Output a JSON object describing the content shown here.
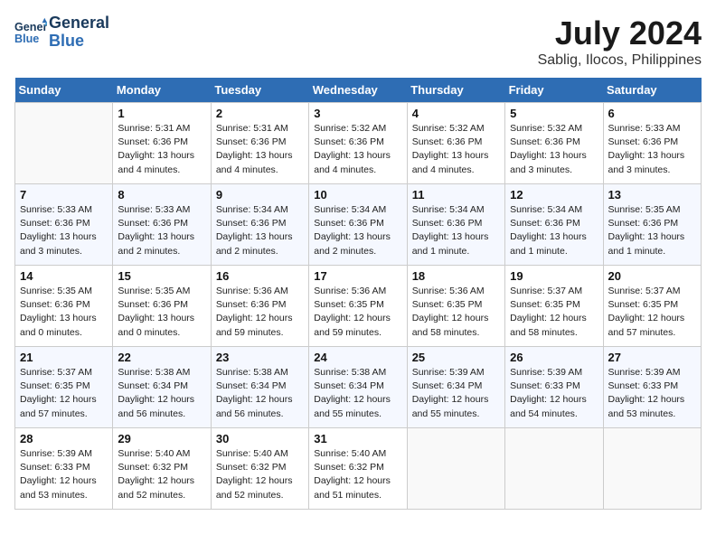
{
  "header": {
    "logo_line1": "General",
    "logo_line2": "Blue",
    "month_year": "July 2024",
    "location": "Sablig, Ilocos, Philippines"
  },
  "weekdays": [
    "Sunday",
    "Monday",
    "Tuesday",
    "Wednesday",
    "Thursday",
    "Friday",
    "Saturday"
  ],
  "weeks": [
    [
      {
        "num": "",
        "info": ""
      },
      {
        "num": "1",
        "info": "Sunrise: 5:31 AM\nSunset: 6:36 PM\nDaylight: 13 hours\nand 4 minutes."
      },
      {
        "num": "2",
        "info": "Sunrise: 5:31 AM\nSunset: 6:36 PM\nDaylight: 13 hours\nand 4 minutes."
      },
      {
        "num": "3",
        "info": "Sunrise: 5:32 AM\nSunset: 6:36 PM\nDaylight: 13 hours\nand 4 minutes."
      },
      {
        "num": "4",
        "info": "Sunrise: 5:32 AM\nSunset: 6:36 PM\nDaylight: 13 hours\nand 4 minutes."
      },
      {
        "num": "5",
        "info": "Sunrise: 5:32 AM\nSunset: 6:36 PM\nDaylight: 13 hours\nand 3 minutes."
      },
      {
        "num": "6",
        "info": "Sunrise: 5:33 AM\nSunset: 6:36 PM\nDaylight: 13 hours\nand 3 minutes."
      }
    ],
    [
      {
        "num": "7",
        "info": "Sunrise: 5:33 AM\nSunset: 6:36 PM\nDaylight: 13 hours\nand 3 minutes."
      },
      {
        "num": "8",
        "info": "Sunrise: 5:33 AM\nSunset: 6:36 PM\nDaylight: 13 hours\nand 2 minutes."
      },
      {
        "num": "9",
        "info": "Sunrise: 5:34 AM\nSunset: 6:36 PM\nDaylight: 13 hours\nand 2 minutes."
      },
      {
        "num": "10",
        "info": "Sunrise: 5:34 AM\nSunset: 6:36 PM\nDaylight: 13 hours\nand 2 minutes."
      },
      {
        "num": "11",
        "info": "Sunrise: 5:34 AM\nSunset: 6:36 PM\nDaylight: 13 hours\nand 1 minute."
      },
      {
        "num": "12",
        "info": "Sunrise: 5:34 AM\nSunset: 6:36 PM\nDaylight: 13 hours\nand 1 minute."
      },
      {
        "num": "13",
        "info": "Sunrise: 5:35 AM\nSunset: 6:36 PM\nDaylight: 13 hours\nand 1 minute."
      }
    ],
    [
      {
        "num": "14",
        "info": "Sunrise: 5:35 AM\nSunset: 6:36 PM\nDaylight: 13 hours\nand 0 minutes."
      },
      {
        "num": "15",
        "info": "Sunrise: 5:35 AM\nSunset: 6:36 PM\nDaylight: 13 hours\nand 0 minutes."
      },
      {
        "num": "16",
        "info": "Sunrise: 5:36 AM\nSunset: 6:36 PM\nDaylight: 12 hours\nand 59 minutes."
      },
      {
        "num": "17",
        "info": "Sunrise: 5:36 AM\nSunset: 6:35 PM\nDaylight: 12 hours\nand 59 minutes."
      },
      {
        "num": "18",
        "info": "Sunrise: 5:36 AM\nSunset: 6:35 PM\nDaylight: 12 hours\nand 58 minutes."
      },
      {
        "num": "19",
        "info": "Sunrise: 5:37 AM\nSunset: 6:35 PM\nDaylight: 12 hours\nand 58 minutes."
      },
      {
        "num": "20",
        "info": "Sunrise: 5:37 AM\nSunset: 6:35 PM\nDaylight: 12 hours\nand 57 minutes."
      }
    ],
    [
      {
        "num": "21",
        "info": "Sunrise: 5:37 AM\nSunset: 6:35 PM\nDaylight: 12 hours\nand 57 minutes."
      },
      {
        "num": "22",
        "info": "Sunrise: 5:38 AM\nSunset: 6:34 PM\nDaylight: 12 hours\nand 56 minutes."
      },
      {
        "num": "23",
        "info": "Sunrise: 5:38 AM\nSunset: 6:34 PM\nDaylight: 12 hours\nand 56 minutes."
      },
      {
        "num": "24",
        "info": "Sunrise: 5:38 AM\nSunset: 6:34 PM\nDaylight: 12 hours\nand 55 minutes."
      },
      {
        "num": "25",
        "info": "Sunrise: 5:39 AM\nSunset: 6:34 PM\nDaylight: 12 hours\nand 55 minutes."
      },
      {
        "num": "26",
        "info": "Sunrise: 5:39 AM\nSunset: 6:33 PM\nDaylight: 12 hours\nand 54 minutes."
      },
      {
        "num": "27",
        "info": "Sunrise: 5:39 AM\nSunset: 6:33 PM\nDaylight: 12 hours\nand 53 minutes."
      }
    ],
    [
      {
        "num": "28",
        "info": "Sunrise: 5:39 AM\nSunset: 6:33 PM\nDaylight: 12 hours\nand 53 minutes."
      },
      {
        "num": "29",
        "info": "Sunrise: 5:40 AM\nSunset: 6:32 PM\nDaylight: 12 hours\nand 52 minutes."
      },
      {
        "num": "30",
        "info": "Sunrise: 5:40 AM\nSunset: 6:32 PM\nDaylight: 12 hours\nand 52 minutes."
      },
      {
        "num": "31",
        "info": "Sunrise: 5:40 AM\nSunset: 6:32 PM\nDaylight: 12 hours\nand 51 minutes."
      },
      {
        "num": "",
        "info": ""
      },
      {
        "num": "",
        "info": ""
      },
      {
        "num": "",
        "info": ""
      }
    ]
  ]
}
